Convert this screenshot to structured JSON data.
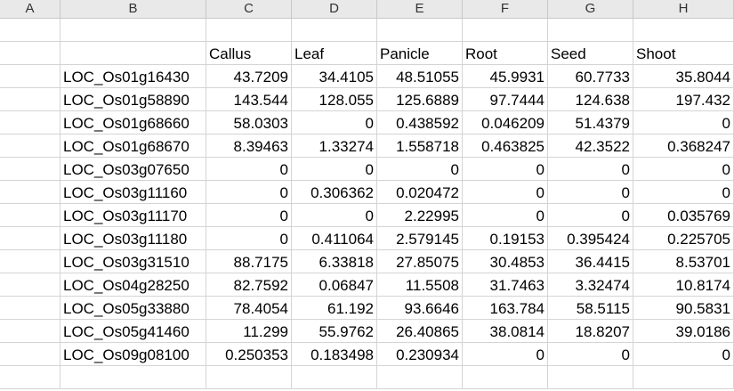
{
  "columns": [
    "A",
    "B",
    "C",
    "D",
    "E",
    "F",
    "G",
    "H"
  ],
  "table": {
    "headers": [
      "",
      "",
      "Callus",
      "Leaf",
      "Panicle",
      "Root",
      "Seed",
      "Shoot"
    ],
    "rows": [
      [
        "",
        "LOC_Os01g16430",
        "43.7209",
        "34.4105",
        "48.51055",
        "45.9931",
        "60.7733",
        "35.8044"
      ],
      [
        "",
        "LOC_Os01g58890",
        "143.544",
        "128.055",
        "125.6889",
        "97.7444",
        "124.638",
        "197.432"
      ],
      [
        "",
        "LOC_Os01g68660",
        "58.0303",
        "0",
        "0.438592",
        "0.046209",
        "51.4379",
        "0"
      ],
      [
        "",
        "LOC_Os01g68670",
        "8.39463",
        "1.33274",
        "1.558718",
        "0.463825",
        "42.3522",
        "0.368247"
      ],
      [
        "",
        "LOC_Os03g07650",
        "0",
        "0",
        "0",
        "0",
        "0",
        "0"
      ],
      [
        "",
        "LOC_Os03g11160",
        "0",
        "0.306362",
        "0.020472",
        "0",
        "0",
        "0"
      ],
      [
        "",
        "LOC_Os03g11170",
        "0",
        "0",
        "2.22995",
        "0",
        "0",
        "0.035769"
      ],
      [
        "",
        "LOC_Os03g11180",
        "0",
        "0.411064",
        "2.579145",
        "0.19153",
        "0.395424",
        "0.225705"
      ],
      [
        "",
        "LOC_Os03g31510",
        "88.7175",
        "6.33818",
        "27.85075",
        "30.4853",
        "36.4415",
        "8.53701"
      ],
      [
        "",
        "LOC_Os04g28250",
        "82.7592",
        "0.06847",
        "11.5508",
        "31.7463",
        "3.32474",
        "10.8174"
      ],
      [
        "",
        "LOC_Os05g33880",
        "78.4054",
        "61.192",
        "93.6646",
        "163.784",
        "58.5115",
        "90.5831"
      ],
      [
        "",
        "LOC_Os05g41460",
        "11.299",
        "55.9762",
        "26.40865",
        "38.0814",
        "18.8207",
        "39.0186"
      ],
      [
        "",
        "LOC_Os09g08100",
        "0.250353",
        "0.183498",
        "0.230934",
        "0",
        "0",
        "0"
      ]
    ]
  }
}
